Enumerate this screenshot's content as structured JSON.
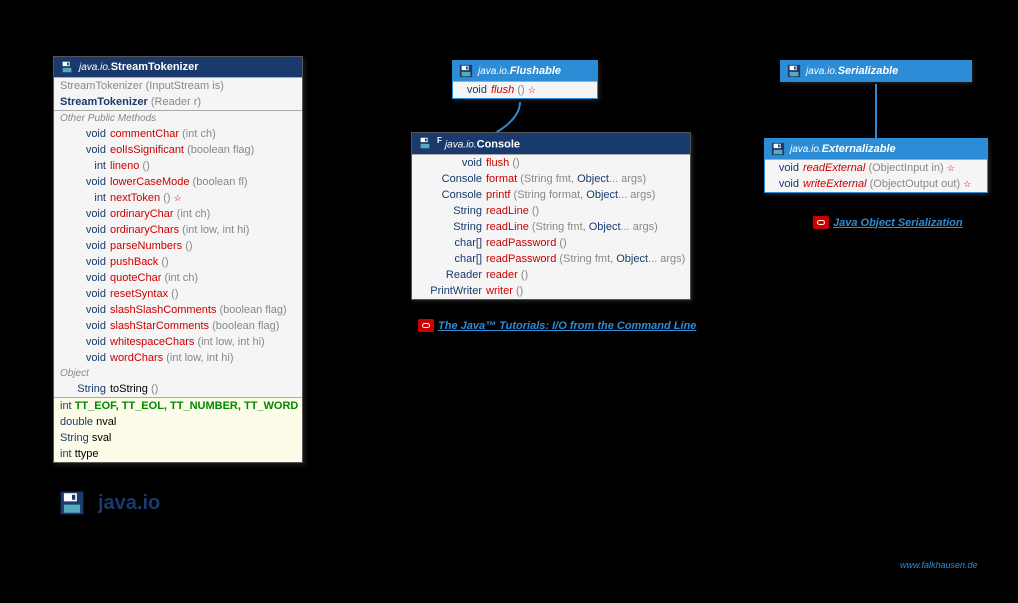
{
  "pkg": "java.io",
  "streamTokenizer": {
    "title": "StreamTokenizer",
    "pkg": "java.io.",
    "ctor1": "StreamTokenizer",
    "ctor1p": "(InputStream is)",
    "ctor2": "StreamTokenizer",
    "ctor2p": "(Reader r)",
    "secLabel": "Other Public Methods",
    "rows": [
      {
        "ret": "void",
        "name": "commentChar",
        "p": "(int ch)"
      },
      {
        "ret": "void",
        "name": "eolIsSignificant",
        "p": "(boolean flag)"
      },
      {
        "ret": "int",
        "name": "lineno",
        "p": "()"
      },
      {
        "ret": "void",
        "name": "lowerCaseMode",
        "p": "(boolean fl)"
      },
      {
        "ret": "int",
        "name": "nextToken",
        "p": "()",
        "throws": "☆"
      },
      {
        "ret": "void",
        "name": "ordinaryChar",
        "p": "(int ch)"
      },
      {
        "ret": "void",
        "name": "ordinaryChars",
        "p": "(int low, int hi)"
      },
      {
        "ret": "void",
        "name": "parseNumbers",
        "p": "()"
      },
      {
        "ret": "void",
        "name": "pushBack",
        "p": "()"
      },
      {
        "ret": "void",
        "name": "quoteChar",
        "p": "(int ch)"
      },
      {
        "ret": "void",
        "name": "resetSyntax",
        "p": "()"
      },
      {
        "ret": "void",
        "name": "slashSlashComments",
        "p": "(boolean flag)"
      },
      {
        "ret": "void",
        "name": "slashStarComments",
        "p": "(boolean flag)"
      },
      {
        "ret": "void",
        "name": "whitespaceChars",
        "p": "(int low, int hi)"
      },
      {
        "ret": "void",
        "name": "wordChars",
        "p": "(int low, int hi)"
      }
    ],
    "objLabel": "Object",
    "toStringRet": "String",
    "toStringName": "toString",
    "toStringP": "()",
    "fields": [
      {
        "t": "int",
        "v": "TT_EOF, TT_EOL, TT_NUMBER, TT_WORD",
        "const": true
      },
      {
        "t": "double",
        "v": "nval",
        "const": false
      },
      {
        "t": "String",
        "v": "sval",
        "const": false
      },
      {
        "t": "int",
        "v": "ttype",
        "const": false
      }
    ]
  },
  "flushable": {
    "title": "Flushable",
    "pkg": "java.io.",
    "row": {
      "ret": "void",
      "name": "flush",
      "p": "()",
      "throws": "☆"
    }
  },
  "console": {
    "title": "Console",
    "pkg": "java.io.",
    "sup": "F",
    "rows": [
      {
        "ret": "void",
        "name": "flush",
        "p": "()"
      },
      {
        "ret": "Console",
        "name": "format",
        "p1": "(String fmt, ",
        "p2": "Object",
        "p3": "... args)"
      },
      {
        "ret": "Console",
        "name": "printf",
        "p1": "(String format, ",
        "p2": "Object",
        "p3": "... args)"
      },
      {
        "ret": "String",
        "name": "readLine",
        "p": "()"
      },
      {
        "ret": "String",
        "name": "readLine",
        "p1": "(String fmt, ",
        "p2": "Object",
        "p3": "... args)"
      },
      {
        "ret": "char[]",
        "name": "readPassword",
        "p": "()"
      },
      {
        "ret": "char[]",
        "name": "readPassword",
        "p1": "(String fmt, ",
        "p2": "Object",
        "p3": "... args)"
      },
      {
        "ret": "Reader",
        "name": "reader",
        "p": "()"
      },
      {
        "ret": "PrintWriter",
        "name": "writer",
        "p": "()"
      }
    ]
  },
  "serializable": {
    "title": "Serializable",
    "pkg": "java.io."
  },
  "externalizable": {
    "title": "Externalizable",
    "pkg": "java.io.",
    "rows": [
      {
        "ret": "void",
        "name": "readExternal",
        "p": "(ObjectInput in)",
        "throws": "☆"
      },
      {
        "ret": "void",
        "name": "writeExternal",
        "p": "(ObjectOutput out)",
        "throws": "☆"
      }
    ]
  },
  "links": {
    "tutorial": "The Java™ Tutorials: I/O from the Command Line",
    "serialization": "Java Object Serialization"
  },
  "credit": "www.falkhausen.de",
  "bigLogo": "java.io"
}
